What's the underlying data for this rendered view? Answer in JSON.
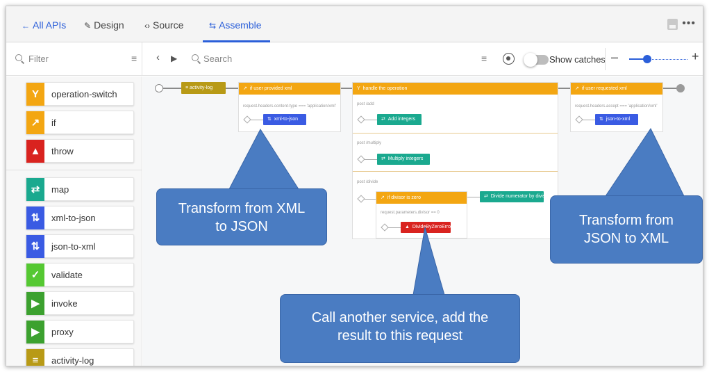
{
  "tabs": {
    "all_apis": "All APIs",
    "design": "Design",
    "source": "Source",
    "assemble": "Assemble"
  },
  "toolbar": {
    "filter_placeholder": "Filter",
    "search_placeholder": "Search",
    "show_catches_label": "Show catches",
    "show_catches_on": false,
    "zoom_minus": "–",
    "zoom_plus": "+"
  },
  "palette": {
    "items": [
      {
        "label": "operation-switch",
        "icon": "switch-icon",
        "color": "#f3a612"
      },
      {
        "label": "if",
        "icon": "if-arrow-icon",
        "color": "#f3a612"
      },
      {
        "label": "throw",
        "icon": "warning-icon",
        "color": "#d9231f"
      },
      {
        "label": "map",
        "icon": "map-arrows-icon",
        "color": "#1aa98f"
      },
      {
        "label": "xml-to-json",
        "icon": "transform-icon",
        "color": "#3a5be3"
      },
      {
        "label": "json-to-xml",
        "icon": "transform-icon",
        "color": "#3a5be3"
      },
      {
        "label": "validate",
        "icon": "checkmark-icon",
        "color": "#55c832"
      },
      {
        "label": "invoke",
        "icon": "play-icon",
        "color": "#3ca12f"
      },
      {
        "label": "proxy",
        "icon": "play-icon",
        "color": "#3ca12f"
      },
      {
        "label": "activity-log",
        "icon": "list-icon",
        "color": "#b89a16"
      }
    ]
  },
  "flow": {
    "activity_log": "activity-log",
    "if_xml": {
      "header": "if user provided xml",
      "condition": "request.headers.content-type === 'application/xml'",
      "action": "xml-to-json"
    },
    "switch": {
      "header": "handle the operation",
      "cases": [
        {
          "label": "post /add",
          "action": "Add integers"
        },
        {
          "label": "post /multiply",
          "action": "Multiply integers"
        },
        {
          "label": "post /divide"
        }
      ],
      "if_zero": {
        "header": "if divisor is zero",
        "condition": "request.parameters.divisor == 0",
        "action": "DivideByZeroError"
      },
      "divide_action": "Divide numerator by divisor"
    },
    "if_json": {
      "header": "if user requested xml",
      "condition": "request.headers.accept === 'application/xml'",
      "action": "json-to-xml"
    }
  },
  "callouts": {
    "xml_to_json": "Transform from XML to JSON",
    "json_to_xml": "Transform from JSON to XML",
    "invoke": "Call another service, add the result to this request"
  }
}
